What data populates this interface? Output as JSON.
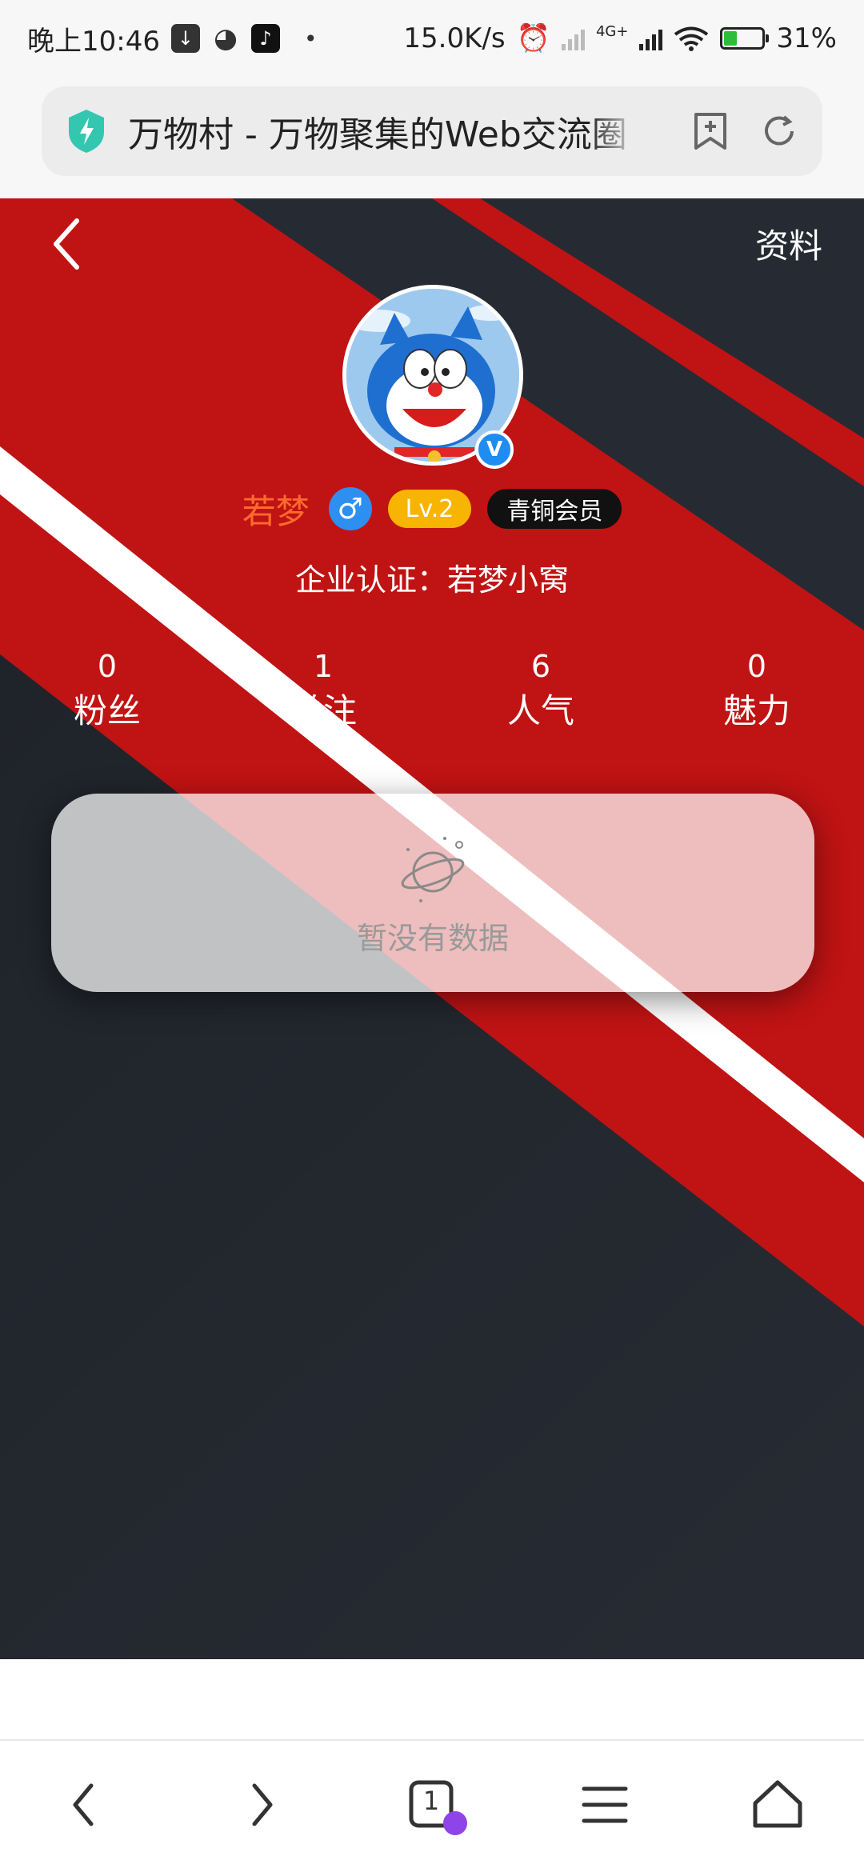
{
  "status_bar": {
    "time": "晚上10:46",
    "speed": "15.0K/s",
    "net_type": "4G+",
    "battery": "31%"
  },
  "browser": {
    "page_title": "万物村 - 万物聚集的Web交流圈"
  },
  "profile": {
    "info_link": "资料",
    "username": "若梦",
    "gender_symbol": "♂",
    "level": "Lv.2",
    "vip_badge": "青铜会员",
    "certification": "企业认证：若梦小窝",
    "verified_mark": "V",
    "stats": [
      {
        "value": "0",
        "label": "粉丝"
      },
      {
        "value": "1",
        "label": "关注"
      },
      {
        "value": "6",
        "label": "人气"
      },
      {
        "value": "0",
        "label": "魅力"
      }
    ],
    "empty_text": "暂没有数据"
  },
  "bottom_nav": {
    "tab_count": "1"
  },
  "colors": {
    "banner_red": "#c01314",
    "banner_dark": "#262b33",
    "username": "#ff6a2b",
    "gender": "#2d8ff0",
    "level": "#f7b400",
    "verify": "#1e8cf0"
  }
}
